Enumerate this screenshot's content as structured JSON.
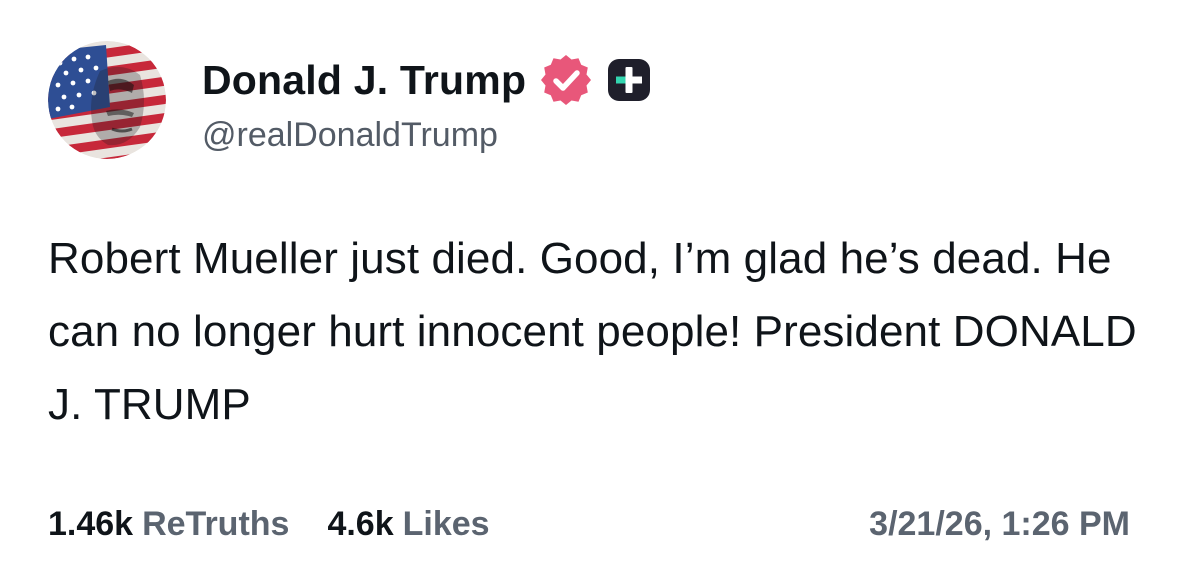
{
  "author": {
    "display_name": "Donald J. Trump",
    "handle": "@realDonaldTrump",
    "avatar_icon": "american-flag-portrait-icon",
    "verified_icon": "verified-badge-icon",
    "verified_color": "#e8577a",
    "plus_badge_icon": "truth-plus-badge-icon",
    "plus_badge_color": "#1f1f2b",
    "plus_badge_accent": "#33d6b0"
  },
  "post": {
    "text": "Robert Mueller just died. Good, I’m glad he’s dead. He can no longer hurt innocent people! President DONALD J. TRUMP"
  },
  "stats": {
    "retruths_count": "1.46k",
    "retruths_label": "ReTruths",
    "likes_count": "4.6k",
    "likes_label": "Likes"
  },
  "timestamp": "3/21/26, 1:26 PM"
}
